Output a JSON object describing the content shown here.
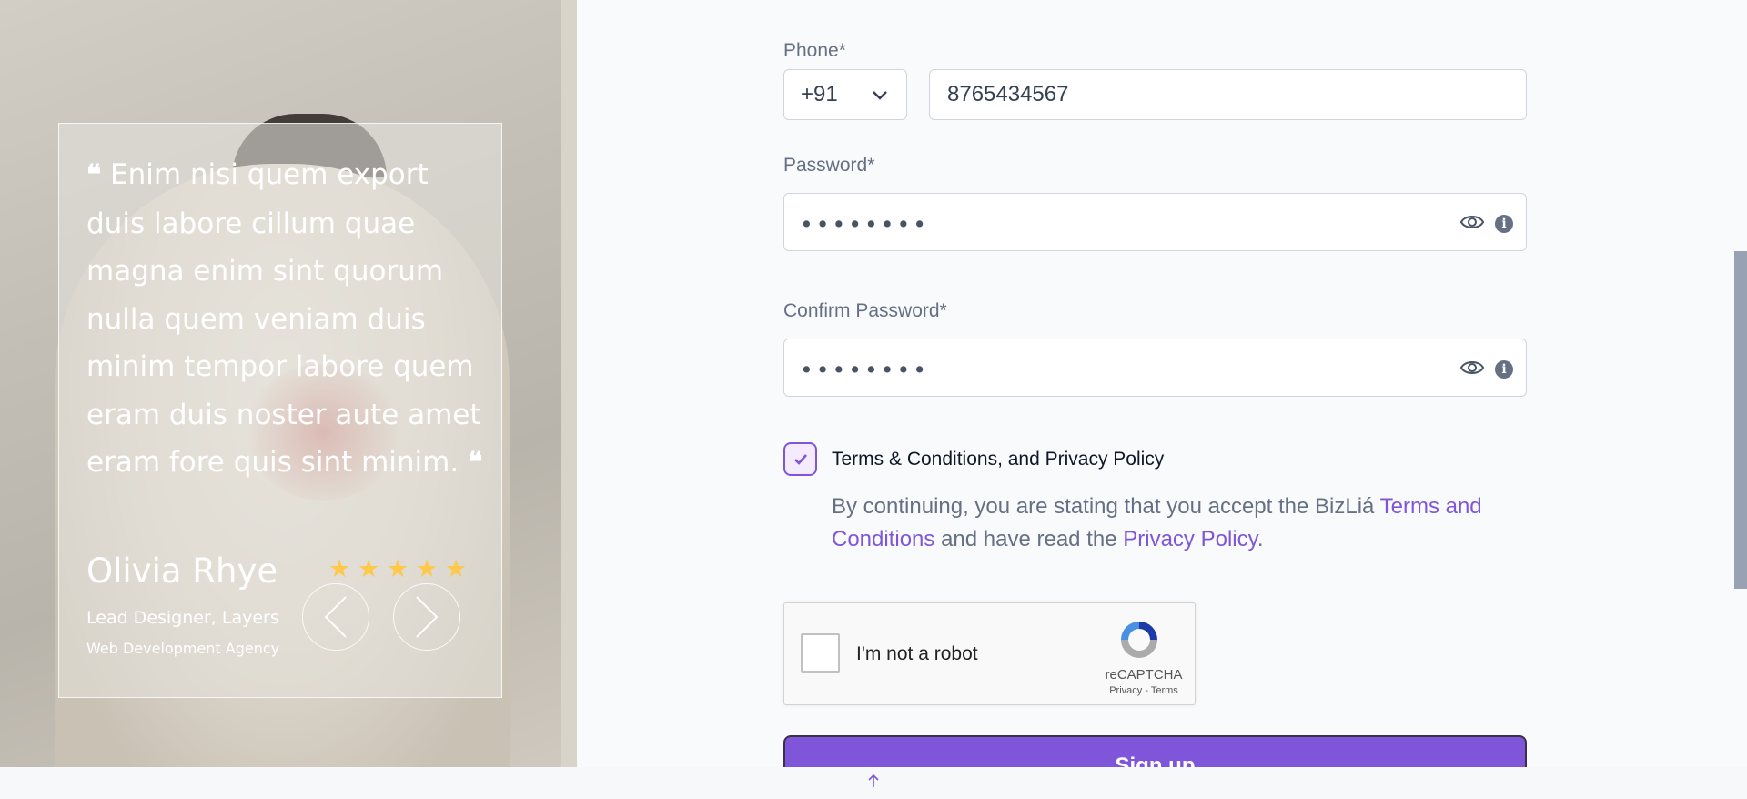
{
  "testimonial": {
    "quote": "Enim nisi quem export duis labore cillum quae magna enim sint quorum nulla quem veniam duis minim tempor labore quem eram duis noster aute amet eram fore quis sint minim.",
    "quote_mark_open": "❝",
    "quote_mark_close": "❝",
    "author": "Olivia Rhye",
    "role": "Lead Designer, Layers",
    "company": "Web Development Agency",
    "rating": 5,
    "prev_icon": "chevron-left-icon",
    "next_icon": "chevron-right-icon"
  },
  "form": {
    "phone": {
      "label": "Phone*",
      "country_code": "+91",
      "value": "8765434567"
    },
    "password": {
      "label": "Password*",
      "masked": "••••••••"
    },
    "confirm_password": {
      "label": "Confirm Password*",
      "masked": "••••••••"
    },
    "terms": {
      "checked": true,
      "label": "Terms & Conditions, and Privacy Policy",
      "desc_prefix": "By continuing, you are stating that you accept the BizLiá ",
      "terms_link": "Terms and Conditions",
      "desc_middle": " and have read the ",
      "privacy_link": "Privacy Policy",
      "desc_suffix": "."
    },
    "captcha": {
      "label": "I'm not a robot",
      "brand": "reCAPTCHA",
      "links": "Privacy - Terms"
    },
    "submit_label": "Sign up"
  },
  "colors": {
    "accent": "#7f56d9",
    "star": "#fec84b",
    "text_muted": "#667085"
  }
}
